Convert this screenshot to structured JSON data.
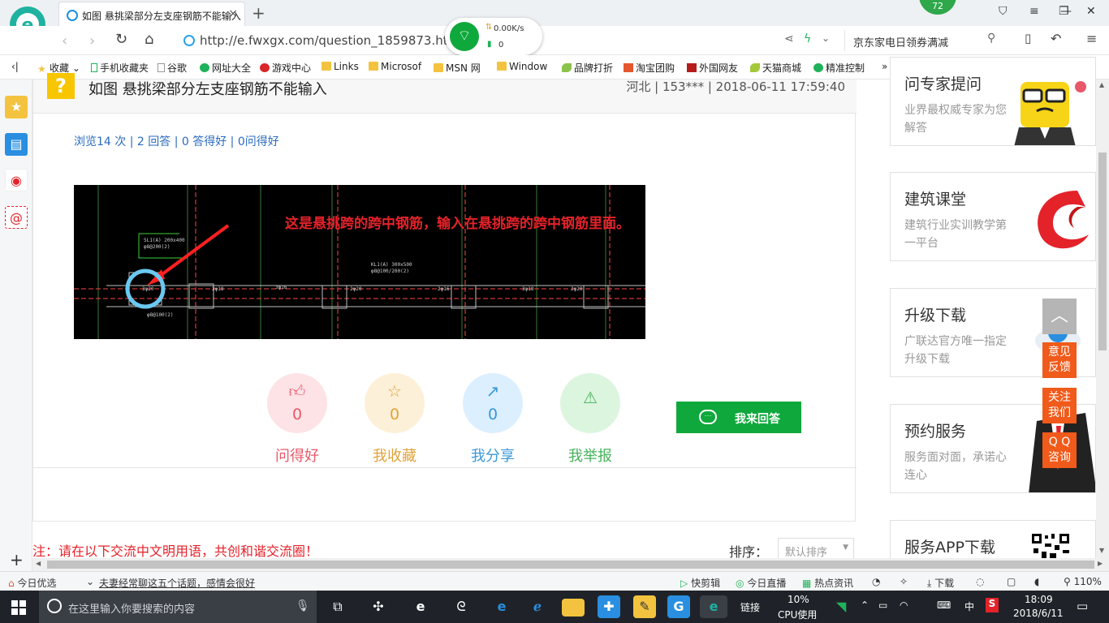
{
  "browser": {
    "tab_title": "如图 悬挑梁部分左支座钢筋不能输入",
    "url": "http://e.fwxgx.com/question_1859873.htm",
    "search_text": "京东家电日领券满减",
    "badge_count": "72",
    "wifi_speed": "0.00K/s",
    "wifi_count": "0"
  },
  "bookmarks": [
    {
      "label": "收藏"
    },
    {
      "label": "手机收藏夹"
    },
    {
      "label": "谷歌"
    },
    {
      "label": "网址大全"
    },
    {
      "label": "游戏中心"
    },
    {
      "label": "Links"
    },
    {
      "label": "Microsof"
    },
    {
      "label": "MSN 网"
    },
    {
      "label": "Window"
    },
    {
      "label": "品牌打折"
    },
    {
      "label": "淘宝团购"
    },
    {
      "label": "外国网友"
    },
    {
      "label": "天猫商城"
    },
    {
      "label": "精准控制"
    }
  ],
  "question": {
    "icon": "?",
    "title": "如图 悬挑梁部分左支座钢筋不能输入",
    "meta": "河北 | 153*** | 2018-06-11 17:59:40",
    "stats": "浏览14 次 | 2 回答 | 0 答得好 | 0问得好",
    "image_caption": "这是悬挑跨的跨中钢筋，输入在悬挑跨的跨中钢筋里面。"
  },
  "actions": [
    {
      "label": "问得好",
      "count": "0",
      "color": "#e8586a",
      "bg": "#fde3e6"
    },
    {
      "label": "我收藏",
      "count": "0",
      "color": "#e0a33a",
      "bg": "#fdf0d8"
    },
    {
      "label": "我分享",
      "count": "0",
      "color": "#3a98d8",
      "bg": "#dcefff"
    },
    {
      "label": "我举报",
      "count": "0",
      "color": "#46b35a",
      "bg": "#dcf5df"
    }
  ],
  "answer_button": "我来回答",
  "notice": "注：请在以下交流中文明用语，共创和谐交流圈！",
  "sort": {
    "label": "排序：",
    "value": "默认排序"
  },
  "ads": [
    {
      "title": "问专家提问",
      "desc": "业界最权威专家为您解答"
    },
    {
      "title": "建筑课堂",
      "desc": "建筑行业实训教学第一平台"
    },
    {
      "title": "升级下载",
      "desc": "广联达官方唯一指定升级下载"
    },
    {
      "title": "预约服务",
      "desc": "服务面对面，承诺心连心"
    },
    {
      "title": "服务APP下载",
      "desc": ""
    }
  ],
  "float_buttons": [
    {
      "label": "意见反馈"
    },
    {
      "label": "关注我们"
    },
    {
      "label": "Q Q咨询"
    }
  ],
  "statusbar": {
    "today": "今日优选",
    "headline": "夫妻经常聊这五个话题，感情会很好",
    "kuaijianji": "快剪辑",
    "live": "今日直播",
    "news": "热点资讯",
    "download": "下载",
    "zoom": "110%"
  },
  "taskbar": {
    "search_placeholder": "在这里输入你要搜索的内容",
    "links": "链接",
    "cpu": "10%",
    "cpu_label": "CPU使用",
    "ime": "中",
    "time": "18:09",
    "date": "2018/6/11"
  }
}
